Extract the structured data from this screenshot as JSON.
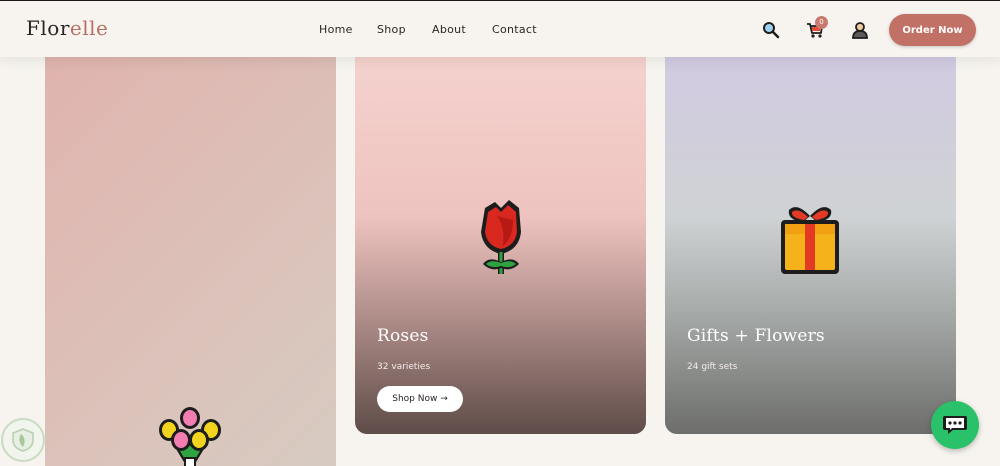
{
  "brand": {
    "logo_main": "Flor",
    "logo_accent": "elle"
  },
  "nav": {
    "items": [
      "Home",
      "Shop",
      "About",
      "Contact"
    ]
  },
  "header": {
    "cart_count": "0",
    "order_button": "Order Now"
  },
  "icons": {
    "search": "search-icon",
    "cart": "cart-icon",
    "account": "user-icon",
    "chat": "chat-icon"
  },
  "cards": [
    {
      "title": "",
      "subtitle": "",
      "button": "",
      "emoji": "bouquet"
    },
    {
      "title": "Roses",
      "subtitle": "32 varieties",
      "button": "Shop Now →",
      "emoji": "rose"
    },
    {
      "title": "Gifts + Flowers",
      "subtitle": "24 gift sets",
      "button": "",
      "emoji": "gift"
    }
  ],
  "colors": {
    "accent": "#c27166",
    "background": "#f7f4ef",
    "chat": "#29c16a"
  }
}
